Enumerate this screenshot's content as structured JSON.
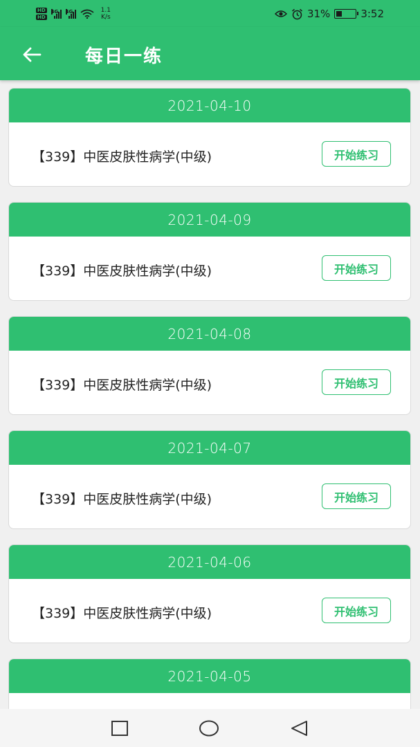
{
  "status_bar": {
    "hd_1": "HD",
    "hd_2": "HD",
    "sig_1_tag": "4G",
    "sig_2_tag": "4G",
    "net_speed_value": "1.1",
    "net_speed_unit": "K/s",
    "battery": "31%",
    "battery_level": 0.31,
    "time": "3:52",
    "icons": [
      "signal-icon",
      "wifi-icon",
      "eye-icon",
      "alarm-icon",
      "battery-icon"
    ]
  },
  "app_bar": {
    "title": "每日一练",
    "back_icon": "arrow-left-icon"
  },
  "theme": {
    "accent": "#2fbf71",
    "background": "#f0f0f0",
    "card": "#ffffff"
  },
  "cards": [
    {
      "date": "2021-04-10",
      "course": "【339】中医皮肤性病学(中级)",
      "button": "开始练习"
    },
    {
      "date": "2021-04-09",
      "course": "【339】中医皮肤性病学(中级)",
      "button": "开始练习"
    },
    {
      "date": "2021-04-08",
      "course": "【339】中医皮肤性病学(中级)",
      "button": "开始练习"
    },
    {
      "date": "2021-04-07",
      "course": "【339】中医皮肤性病学(中级)",
      "button": "开始练习"
    },
    {
      "date": "2021-04-06",
      "course": "【339】中医皮肤性病学(中级)",
      "button": "开始练习"
    },
    {
      "date": "2021-04-05",
      "course": "",
      "button": ""
    }
  ],
  "nav_bar": {
    "icons": [
      "square-recents-icon",
      "circle-home-icon",
      "triangle-back-icon"
    ]
  }
}
